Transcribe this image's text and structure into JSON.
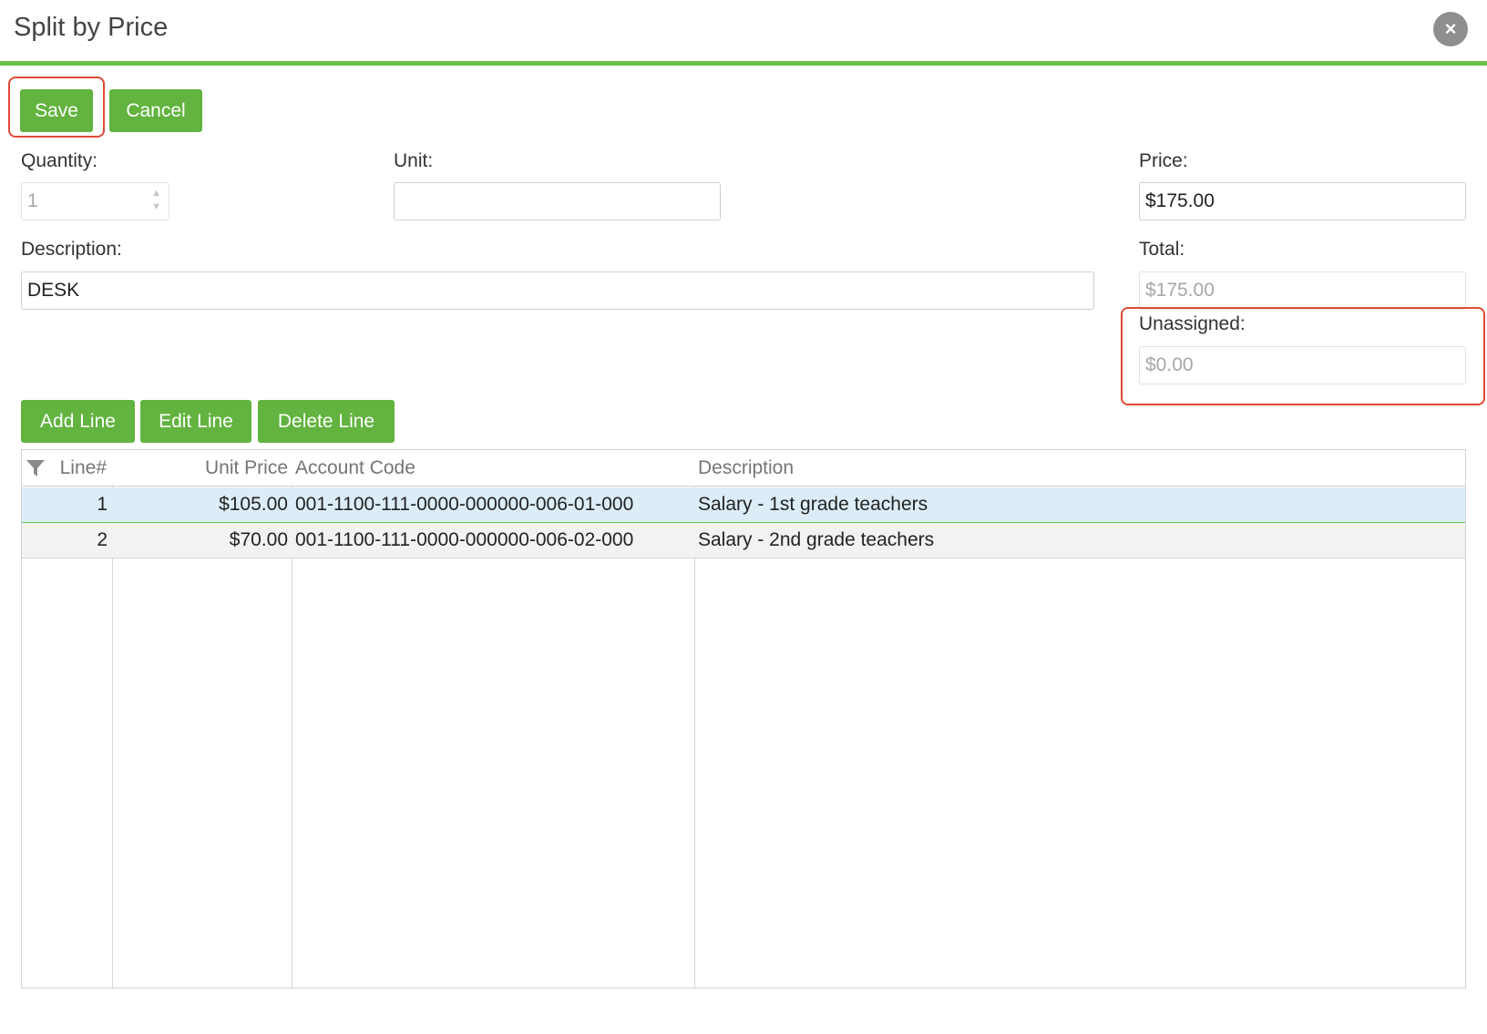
{
  "dialog": {
    "title": "Split by Price",
    "close_icon": "×"
  },
  "actions": {
    "save_label": "Save",
    "cancel_label": "Cancel"
  },
  "form": {
    "quantity_label": "Quantity:",
    "quantity_value": "1",
    "unit_label": "Unit:",
    "unit_value": "",
    "price_label": "Price:",
    "price_value": "$175.00",
    "description_label": "Description:",
    "description_value": "DESK",
    "total_label": "Total:",
    "total_value": "$175.00",
    "unassigned_label": "Unassigned:",
    "unassigned_value": "$0.00"
  },
  "line_actions": {
    "add_label": "Add Line",
    "edit_label": "Edit Line",
    "delete_label": "Delete Line"
  },
  "grid": {
    "columns": [
      "Line#",
      "Unit Price",
      "Account Code",
      "Description"
    ],
    "rows": [
      {
        "line": "1",
        "unit_price": "$105.00",
        "account_code": "001-1100-111-0000-000000-006-01-000",
        "description": "Salary - 1st grade teachers",
        "selected": true
      },
      {
        "line": "2",
        "unit_price": "$70.00",
        "account_code": "001-1100-111-0000-000000-006-02-000",
        "description": "Salary - 2nd grade teachers",
        "selected": false
      }
    ]
  },
  "colors": {
    "accent_green": "#62b33f",
    "highlight_red": "#e04a36",
    "selected_row": "#dcedf7"
  }
}
